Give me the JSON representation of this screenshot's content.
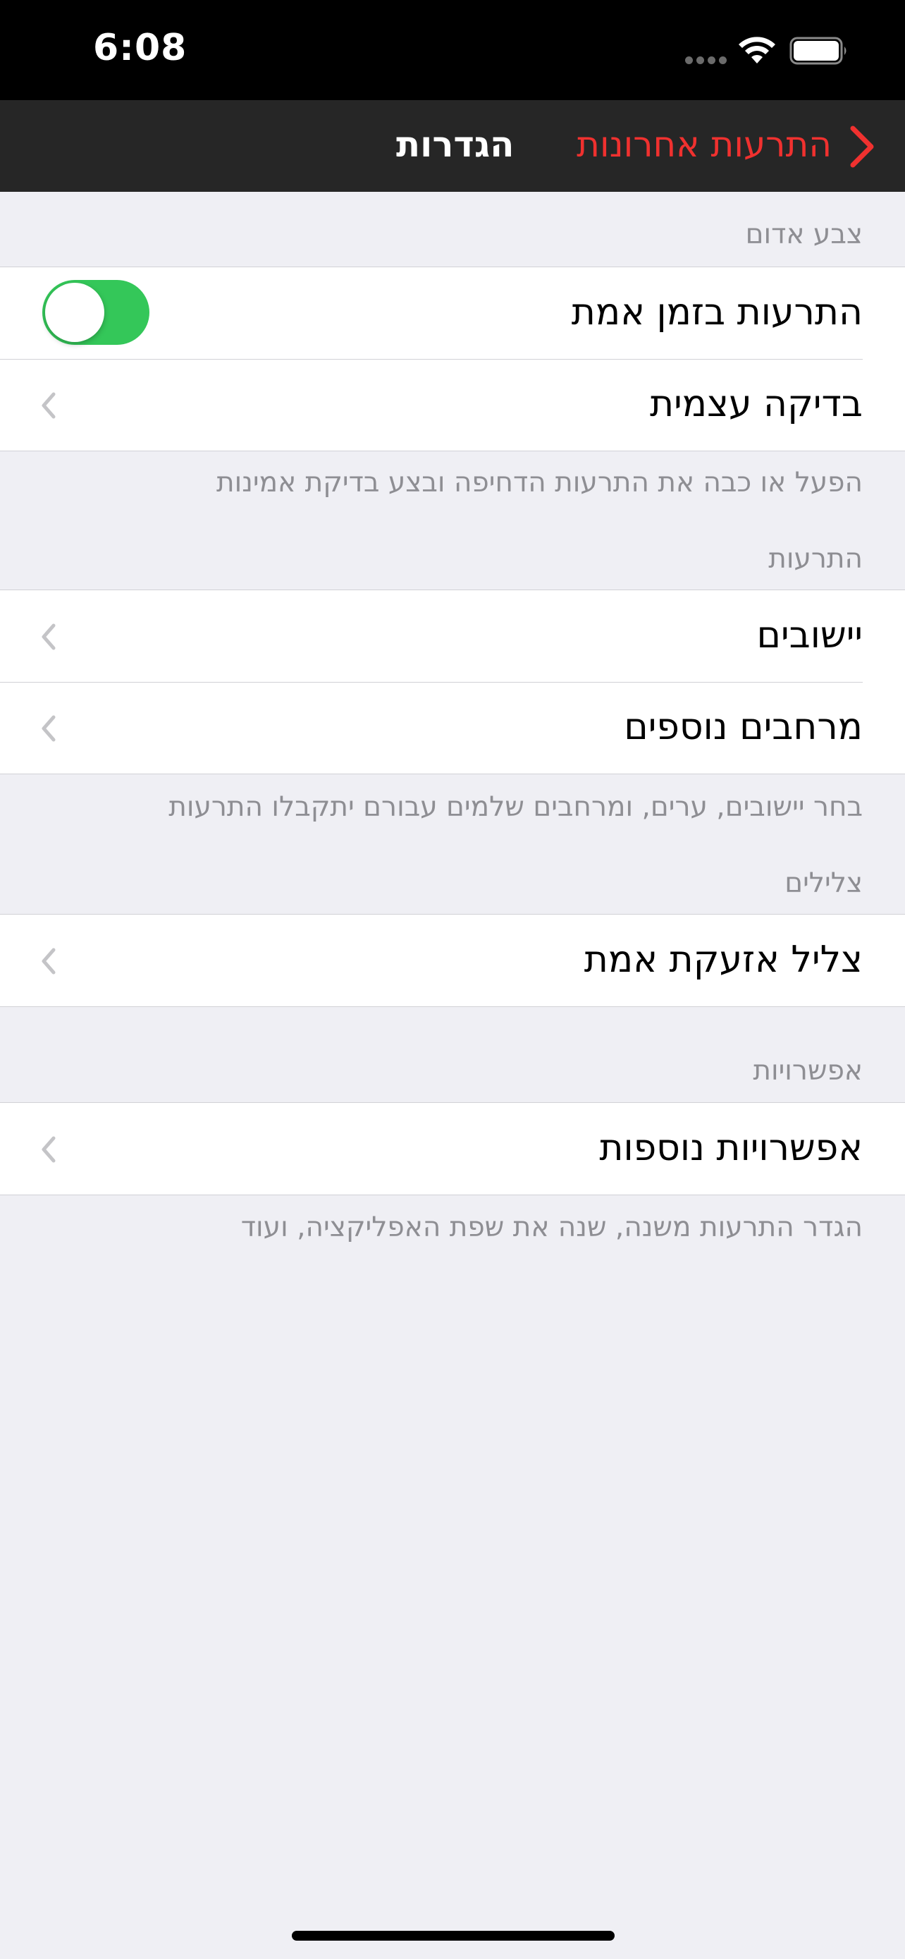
{
  "status_bar": {
    "time": "6:08",
    "signal_icon": "signal-dots-icon",
    "wifi_icon": "wifi-icon",
    "battery_icon": "battery-icon"
  },
  "nav": {
    "title": "הגדרות",
    "back_label": "התרעות אחרונות",
    "back_icon": "chevron-right-icon",
    "accent_color": "#F0312F"
  },
  "sections": {
    "red_alert": {
      "header": "צבע אדום",
      "realtime_label": "התרעות בזמן אמת",
      "realtime_enabled": true,
      "self_test_label": "בדיקה עצמית",
      "footer": "הפעל או כבה את התרעות הדחיפה ובצע בדיקת אמינות"
    },
    "alerts": {
      "header": "התרעות",
      "localities_label": "יישובים",
      "additional_zones_label": "מרחבים נוספים",
      "footer": "בחר יישובים, ערים, ומרחבים שלמים עבורם יתקבלו התרעות"
    },
    "sounds": {
      "header": "צלילים",
      "real_alarm_sound_label": "צליל אזעקת אמת"
    },
    "options": {
      "header": "אפשרויות",
      "more_options_label": "אפשרויות נוספות",
      "footer": "הגדר התרעות משנה, שנה את שפת האפליקציה, ועוד"
    }
  },
  "colors": {
    "toggle_on": "#34C759",
    "background": "#EFEFF4"
  }
}
